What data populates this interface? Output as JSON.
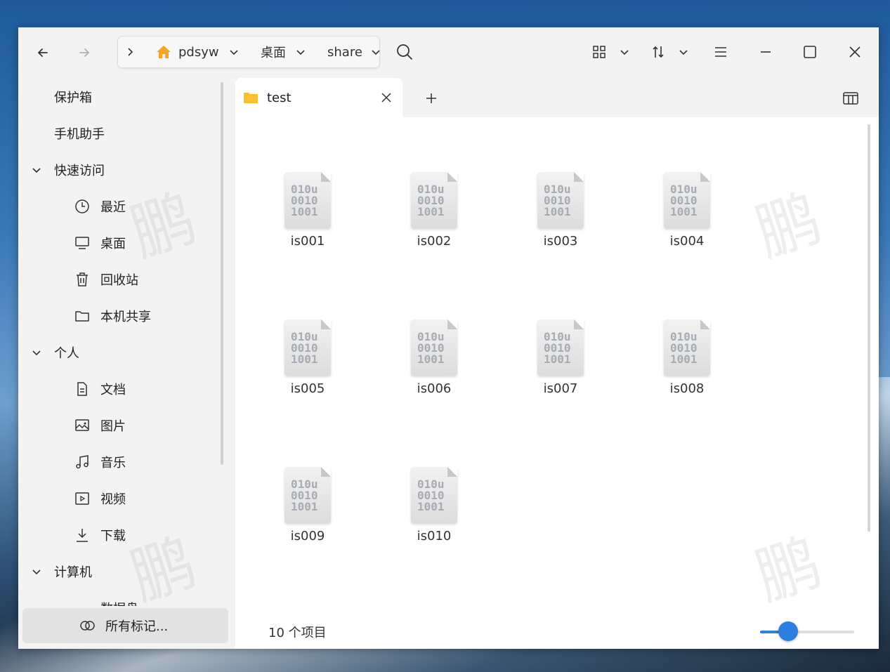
{
  "titlebar": {
    "back_icon": "arrow-left-icon",
    "forward_icon": "arrow-right-icon",
    "breadcrumb": {
      "expand_icon": "chevron-right-icon",
      "home_icon": "home-icon",
      "items": [
        {
          "label": "pdsyw"
        },
        {
          "label": "桌面"
        },
        {
          "label": "share"
        }
      ]
    },
    "search_icon": "search-icon",
    "view_icon": "grid-view-icon",
    "sort_icon": "sort-icon",
    "menu_icon": "menu-icon",
    "minimize_icon": "minimize-icon",
    "maximize_icon": "maximize-icon",
    "close_icon": "close-icon"
  },
  "sidebar": {
    "top_items": [
      {
        "label": "保护箱"
      },
      {
        "label": "手机助手"
      }
    ],
    "quick_access": {
      "label": "快速访问",
      "items": [
        {
          "label": "最近",
          "icon": "clock-icon"
        },
        {
          "label": "桌面",
          "icon": "monitor-icon"
        },
        {
          "label": "回收站",
          "icon": "trash-icon"
        },
        {
          "label": "本机共享",
          "icon": "folder-icon"
        }
      ]
    },
    "personal": {
      "label": "个人",
      "items": [
        {
          "label": "文档",
          "icon": "document-icon"
        },
        {
          "label": "图片",
          "icon": "image-icon"
        },
        {
          "label": "音乐",
          "icon": "music-icon"
        },
        {
          "label": "视频",
          "icon": "video-icon"
        },
        {
          "label": "下载",
          "icon": "download-icon"
        }
      ]
    },
    "computer": {
      "label": "计算机",
      "partial_item": "数据盘"
    },
    "all_tags": "所有标记..."
  },
  "tabs": [
    {
      "label": "test",
      "icon": "folder-icon"
    }
  ],
  "files": [
    {
      "name": "is001"
    },
    {
      "name": "is002"
    },
    {
      "name": "is003"
    },
    {
      "name": "is004"
    },
    {
      "name": "is005"
    },
    {
      "name": "is006"
    },
    {
      "name": "is007"
    },
    {
      "name": "is008"
    },
    {
      "name": "is009"
    },
    {
      "name": "is010"
    }
  ],
  "file_glyph": "010u\n0010\n1001",
  "status": {
    "count_text": "10 个项目",
    "zoom_fraction": 0.3
  },
  "colors": {
    "accent": "#2e7de0",
    "home": "#f5a623",
    "folder": "#f7c12f"
  }
}
